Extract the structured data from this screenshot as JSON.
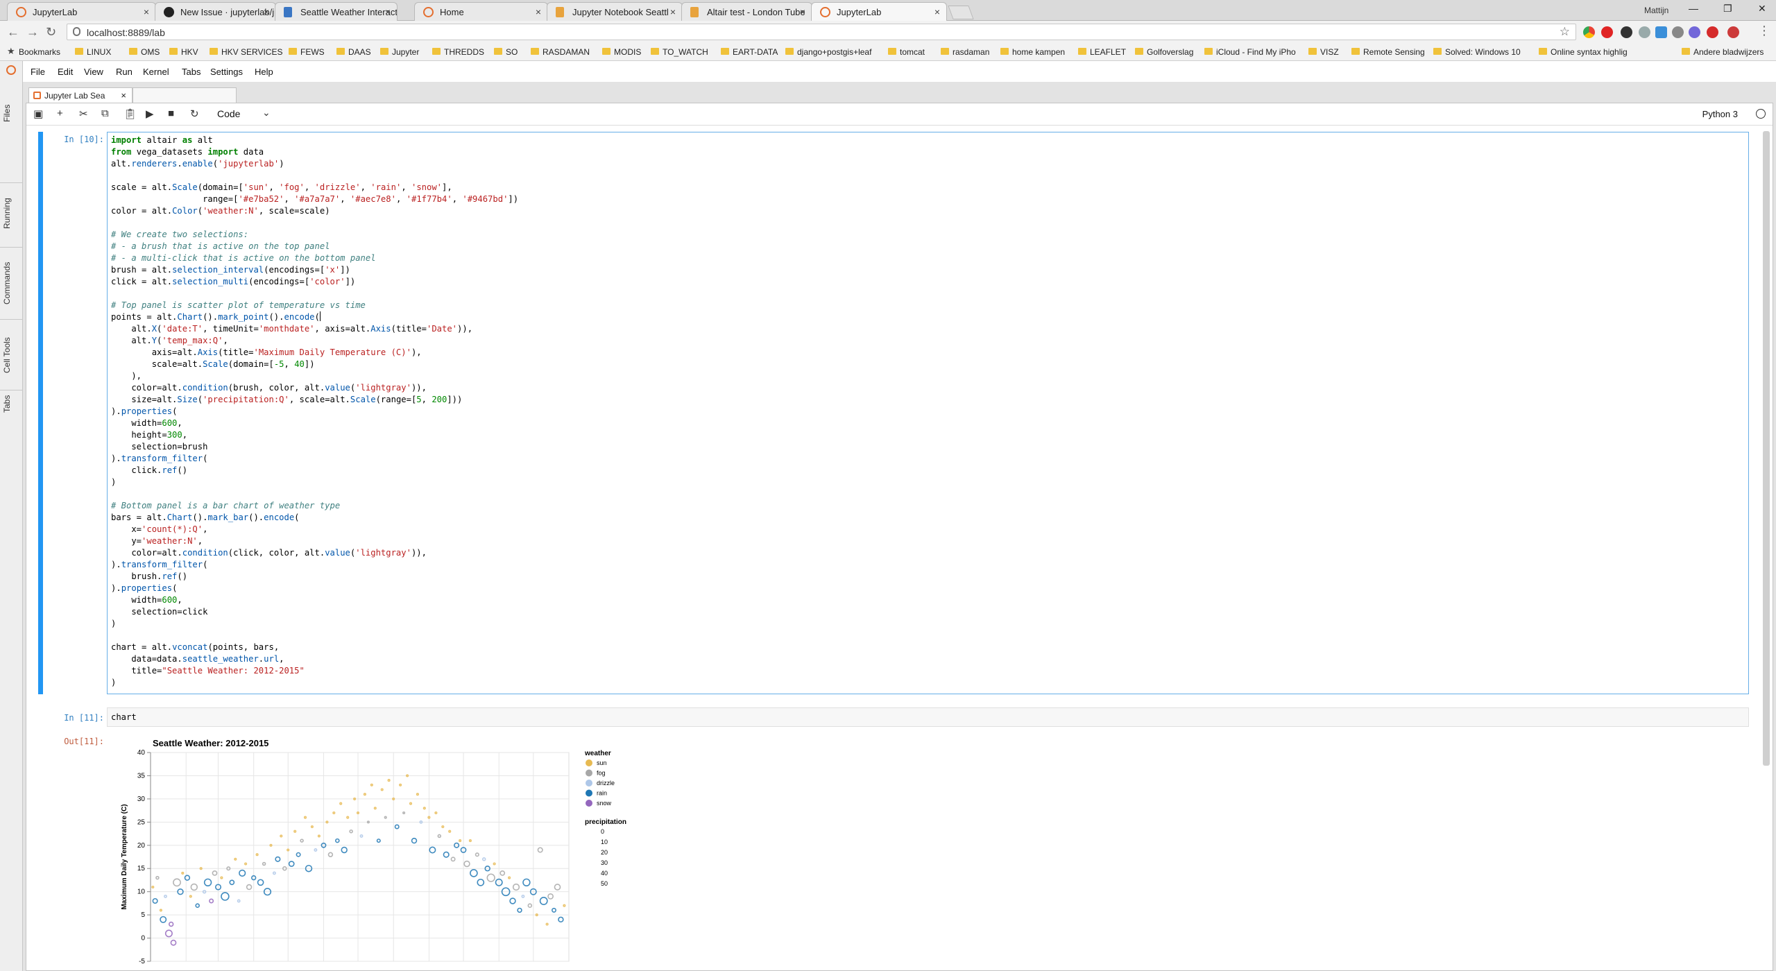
{
  "browser": {
    "tabs": [
      {
        "label": "JupyterLab",
        "icon": "jupyter-icon"
      },
      {
        "label": "New Issue · jupyterlab/ju",
        "icon": "github-icon"
      },
      {
        "label": "Seattle Weather Interacti",
        "icon": "document-icon"
      },
      {
        "label": "Home",
        "icon": "jupyter-icon"
      },
      {
        "label": "Jupyter Notebook Seattl",
        "icon": "notebook-icon"
      },
      {
        "label": "Altair test - London Tube",
        "icon": "notebook-icon"
      },
      {
        "label": "JupyterLab",
        "icon": "jupyter-icon",
        "active": true
      }
    ],
    "profile": "Mattijn",
    "url": "localhost:8889/lab",
    "bookmarks": [
      "Bookmarks",
      "LINUX",
      "OMS",
      "HKV",
      "HKV SERVICES",
      "FEWS",
      "DAAS",
      "Jupyter",
      "THREDDS",
      "SO",
      "RASDAMAN",
      "MODIS",
      "TO_WATCH",
      "EART-DATA",
      "django+postgis+leaf",
      "tomcat",
      "rasdaman",
      "home kampen",
      "LEAFLET",
      "Golfoverslag",
      "iCloud - Find My iPho",
      "VISZ",
      "Remote Sensing",
      "Solved: Windows 10",
      "Online syntax highlig",
      "Andere bladwijzers"
    ]
  },
  "jupyter": {
    "sidebar": [
      "Files",
      "Running",
      "Commands",
      "Cell Tools",
      "Tabs"
    ],
    "menus": [
      "File",
      "Edit",
      "View",
      "Run",
      "Kernel",
      "Tabs",
      "Settings",
      "Help"
    ],
    "doc_tab": "Jupyter Lab Sea",
    "cell_type": "Code",
    "kernel": "Python 3",
    "cells": [
      {
        "prompt": "In [10]:"
      },
      {
        "prompt": "In [11]:",
        "code": "chart"
      },
      {
        "prompt": "Out[11]:"
      }
    ]
  },
  "chart_data": {
    "type": "scatter",
    "title": "Seattle Weather: 2012-2015",
    "ylabel": "Maximum Daily Temperature (C)",
    "ylim": [
      -5,
      40
    ],
    "yticks": [
      -5,
      0,
      5,
      10,
      15,
      20,
      25,
      30,
      35,
      40
    ],
    "x_domain": "month-date, Jan 1 to Dec 31",
    "legend_color_title": "weather",
    "legend_color": [
      {
        "label": "sun",
        "color": "#e7ba52"
      },
      {
        "label": "fog",
        "color": "#a7a7a7"
      },
      {
        "label": "drizzle",
        "color": "#aec7e8"
      },
      {
        "label": "rain",
        "color": "#1f77b4"
      },
      {
        "label": "snow",
        "color": "#9467bd"
      }
    ],
    "legend_size_title": "precipitation",
    "legend_size": [
      0,
      10,
      20,
      30,
      40,
      50
    ],
    "points": [
      {
        "x": "Jan 03",
        "y": 11,
        "weather": "sun",
        "precip": 0
      },
      {
        "x": "Jan 05",
        "y": 8,
        "weather": "rain",
        "precip": 8
      },
      {
        "x": "Jan 07",
        "y": 13,
        "weather": "fog",
        "precip": 2
      },
      {
        "x": "Jan 10",
        "y": 6,
        "weather": "sun",
        "precip": 0
      },
      {
        "x": "Jan 12",
        "y": 4,
        "weather": "rain",
        "precip": 14
      },
      {
        "x": "Jan 14",
        "y": 9,
        "weather": "drizzle",
        "precip": 1
      },
      {
        "x": "Jan 17",
        "y": 1,
        "weather": "snow",
        "precip": 18
      },
      {
        "x": "Jan 19",
        "y": 3,
        "weather": "snow",
        "precip": 6
      },
      {
        "x": "Jan 21",
        "y": -1,
        "weather": "snow",
        "precip": 10
      },
      {
        "x": "Jan 24",
        "y": 12,
        "weather": "fog",
        "precip": 22
      },
      {
        "x": "Jan 27",
        "y": 10,
        "weather": "rain",
        "precip": 12
      },
      {
        "x": "Jan 29",
        "y": 14,
        "weather": "sun",
        "precip": 0
      },
      {
        "x": "Feb 02",
        "y": 13,
        "weather": "rain",
        "precip": 9
      },
      {
        "x": "Feb 05",
        "y": 9,
        "weather": "sun",
        "precip": 0
      },
      {
        "x": "Feb 08",
        "y": 11,
        "weather": "fog",
        "precip": 16
      },
      {
        "x": "Feb 11",
        "y": 7,
        "weather": "rain",
        "precip": 4
      },
      {
        "x": "Feb 14",
        "y": 15,
        "weather": "sun",
        "precip": 0
      },
      {
        "x": "Feb 17",
        "y": 10,
        "weather": "drizzle",
        "precip": 2
      },
      {
        "x": "Feb 20",
        "y": 12,
        "weather": "rain",
        "precip": 20
      },
      {
        "x": "Feb 23",
        "y": 8,
        "weather": "snow",
        "precip": 5
      },
      {
        "x": "Feb 26",
        "y": 14,
        "weather": "fog",
        "precip": 7
      },
      {
        "x": "Mar 01",
        "y": 11,
        "weather": "rain",
        "precip": 11
      },
      {
        "x": "Mar 04",
        "y": 13,
        "weather": "sun",
        "precip": 0
      },
      {
        "x": "Mar 07",
        "y": 9,
        "weather": "rain",
        "precip": 25
      },
      {
        "x": "Mar 10",
        "y": 15,
        "weather": "fog",
        "precip": 3
      },
      {
        "x": "Mar 13",
        "y": 12,
        "weather": "rain",
        "precip": 7
      },
      {
        "x": "Mar 16",
        "y": 17,
        "weather": "sun",
        "precip": 0
      },
      {
        "x": "Mar 19",
        "y": 8,
        "weather": "drizzle",
        "precip": 1
      },
      {
        "x": "Mar 22",
        "y": 14,
        "weather": "rain",
        "precip": 15
      },
      {
        "x": "Mar 25",
        "y": 16,
        "weather": "sun",
        "precip": 0
      },
      {
        "x": "Mar 28",
        "y": 11,
        "weather": "fog",
        "precip": 9
      },
      {
        "x": "Apr 01",
        "y": 13,
        "weather": "rain",
        "precip": 6
      },
      {
        "x": "Apr 04",
        "y": 18,
        "weather": "sun",
        "precip": 0
      },
      {
        "x": "Apr 07",
        "y": 12,
        "weather": "rain",
        "precip": 13
      },
      {
        "x": "Apr 10",
        "y": 16,
        "weather": "fog",
        "precip": 2
      },
      {
        "x": "Apr 13",
        "y": 10,
        "weather": "rain",
        "precip": 19
      },
      {
        "x": "Apr 16",
        "y": 20,
        "weather": "sun",
        "precip": 0
      },
      {
        "x": "Apr 19",
        "y": 14,
        "weather": "drizzle",
        "precip": 1
      },
      {
        "x": "Apr 22",
        "y": 17,
        "weather": "rain",
        "precip": 8
      },
      {
        "x": "Apr 25",
        "y": 22,
        "weather": "sun",
        "precip": 0
      },
      {
        "x": "Apr 28",
        "y": 15,
        "weather": "fog",
        "precip": 4
      },
      {
        "x": "May 01",
        "y": 19,
        "weather": "sun",
        "precip": 0
      },
      {
        "x": "May 04",
        "y": 16,
        "weather": "rain",
        "precip": 10
      },
      {
        "x": "May 07",
        "y": 23,
        "weather": "sun",
        "precip": 0
      },
      {
        "x": "May 10",
        "y": 18,
        "weather": "rain",
        "precip": 5
      },
      {
        "x": "May 13",
        "y": 21,
        "weather": "fog",
        "precip": 2
      },
      {
        "x": "May 16",
        "y": 26,
        "weather": "sun",
        "precip": 0
      },
      {
        "x": "May 19",
        "y": 15,
        "weather": "rain",
        "precip": 16
      },
      {
        "x": "May 22",
        "y": 24,
        "weather": "sun",
        "precip": 0
      },
      {
        "x": "May 25",
        "y": 19,
        "weather": "drizzle",
        "precip": 1
      },
      {
        "x": "May 28",
        "y": 22,
        "weather": "sun",
        "precip": 0
      },
      {
        "x": "Jun 01",
        "y": 20,
        "weather": "rain",
        "precip": 7
      },
      {
        "x": "Jun 04",
        "y": 25,
        "weather": "sun",
        "precip": 0
      },
      {
        "x": "Jun 07",
        "y": 18,
        "weather": "fog",
        "precip": 6
      },
      {
        "x": "Jun 10",
        "y": 27,
        "weather": "sun",
        "precip": 0
      },
      {
        "x": "Jun 13",
        "y": 21,
        "weather": "rain",
        "precip": 4
      },
      {
        "x": "Jun 16",
        "y": 29,
        "weather": "sun",
        "precip": 0
      },
      {
        "x": "Jun 19",
        "y": 19,
        "weather": "rain",
        "precip": 12
      },
      {
        "x": "Jun 22",
        "y": 26,
        "weather": "sun",
        "precip": 0
      },
      {
        "x": "Jun 25",
        "y": 23,
        "weather": "fog",
        "precip": 2
      },
      {
        "x": "Jun 28",
        "y": 30,
        "weather": "sun",
        "precip": 0
      },
      {
        "x": "Jul 01",
        "y": 27,
        "weather": "sun",
        "precip": 0
      },
      {
        "x": "Jul 04",
        "y": 22,
        "weather": "drizzle",
        "precip": 1
      },
      {
        "x": "Jul 07",
        "y": 31,
        "weather": "sun",
        "precip": 0
      },
      {
        "x": "Jul 10",
        "y": 25,
        "weather": "fog",
        "precip": 0
      },
      {
        "x": "Jul 13",
        "y": 33,
        "weather": "sun",
        "precip": 0
      },
      {
        "x": "Jul 16",
        "y": 28,
        "weather": "sun",
        "precip": 0
      },
      {
        "x": "Jul 19",
        "y": 21,
        "weather": "rain",
        "precip": 3
      },
      {
        "x": "Jul 22",
        "y": 32,
        "weather": "sun",
        "precip": 0
      },
      {
        "x": "Jul 25",
        "y": 26,
        "weather": "fog",
        "precip": 0
      },
      {
        "x": "Jul 28",
        "y": 34,
        "weather": "sun",
        "precip": 0
      },
      {
        "x": "Aug 01",
        "y": 30,
        "weather": "sun",
        "precip": 0
      },
      {
        "x": "Aug 04",
        "y": 24,
        "weather": "rain",
        "precip": 5
      },
      {
        "x": "Aug 07",
        "y": 33,
        "weather": "sun",
        "precip": 0
      },
      {
        "x": "Aug 10",
        "y": 27,
        "weather": "fog",
        "precip": 0
      },
      {
        "x": "Aug 13",
        "y": 35,
        "weather": "sun",
        "precip": 0
      },
      {
        "x": "Aug 16",
        "y": 29,
        "weather": "sun",
        "precip": 0
      },
      {
        "x": "Aug 19",
        "y": 21,
        "weather": "rain",
        "precip": 9
      },
      {
        "x": "Aug 22",
        "y": 31,
        "weather": "sun",
        "precip": 0
      },
      {
        "x": "Aug 25",
        "y": 25,
        "weather": "drizzle",
        "precip": 1
      },
      {
        "x": "Aug 28",
        "y": 28,
        "weather": "sun",
        "precip": 0
      },
      {
        "x": "Sep 01",
        "y": 26,
        "weather": "sun",
        "precip": 0
      },
      {
        "x": "Sep 04",
        "y": 19,
        "weather": "rain",
        "precip": 14
      },
      {
        "x": "Sep 07",
        "y": 27,
        "weather": "sun",
        "precip": 0
      },
      {
        "x": "Sep 10",
        "y": 22,
        "weather": "fog",
        "precip": 2
      },
      {
        "x": "Sep 13",
        "y": 24,
        "weather": "sun",
        "precip": 0
      },
      {
        "x": "Sep 16",
        "y": 18,
        "weather": "rain",
        "precip": 11
      },
      {
        "x": "Sep 19",
        "y": 23,
        "weather": "sun",
        "precip": 0
      },
      {
        "x": "Sep 22",
        "y": 17,
        "weather": "fog",
        "precip": 5
      },
      {
        "x": "Sep 25",
        "y": 20,
        "weather": "rain",
        "precip": 8
      },
      {
        "x": "Sep 28",
        "y": 21,
        "weather": "sun",
        "precip": 0
      },
      {
        "x": "Oct 01",
        "y": 19,
        "weather": "rain",
        "precip": 10
      },
      {
        "x": "Oct 04",
        "y": 16,
        "weather": "fog",
        "precip": 12
      },
      {
        "x": "Oct 07",
        "y": 21,
        "weather": "sun",
        "precip": 0
      },
      {
        "x": "Oct 10",
        "y": 14,
        "weather": "rain",
        "precip": 21
      },
      {
        "x": "Oct 13",
        "y": 18,
        "weather": "fog",
        "precip": 3
      },
      {
        "x": "Oct 16",
        "y": 12,
        "weather": "rain",
        "precip": 17
      },
      {
        "x": "Oct 19",
        "y": 17,
        "weather": "drizzle",
        "precip": 2
      },
      {
        "x": "Oct 22",
        "y": 15,
        "weather": "rain",
        "precip": 9
      },
      {
        "x": "Oct 25",
        "y": 13,
        "weather": "fog",
        "precip": 24
      },
      {
        "x": "Oct 28",
        "y": 16,
        "weather": "sun",
        "precip": 0
      },
      {
        "x": "Nov 01",
        "y": 12,
        "weather": "rain",
        "precip": 18
      },
      {
        "x": "Nov 04",
        "y": 14,
        "weather": "fog",
        "precip": 7
      },
      {
        "x": "Nov 07",
        "y": 10,
        "weather": "rain",
        "precip": 26
      },
      {
        "x": "Nov 10",
        "y": 13,
        "weather": "sun",
        "precip": 0
      },
      {
        "x": "Nov 13",
        "y": 8,
        "weather": "rain",
        "precip": 12
      },
      {
        "x": "Nov 16",
        "y": 11,
        "weather": "fog",
        "precip": 15
      },
      {
        "x": "Nov 19",
        "y": 6,
        "weather": "rain",
        "precip": 6
      },
      {
        "x": "Nov 22",
        "y": 9,
        "weather": "drizzle",
        "precip": 1
      },
      {
        "x": "Nov 25",
        "y": 12,
        "weather": "rain",
        "precip": 20
      },
      {
        "x": "Nov 28",
        "y": 7,
        "weather": "fog",
        "precip": 4
      },
      {
        "x": "Dec 01",
        "y": 10,
        "weather": "rain",
        "precip": 14
      },
      {
        "x": "Dec 04",
        "y": 5,
        "weather": "sun",
        "precip": 0
      },
      {
        "x": "Dec 07",
        "y": 19,
        "weather": "fog",
        "precip": 8
      },
      {
        "x": "Dec 10",
        "y": 8,
        "weather": "rain",
        "precip": 22
      },
      {
        "x": "Dec 13",
        "y": 3,
        "weather": "sun",
        "precip": 0
      },
      {
        "x": "Dec 16",
        "y": 9,
        "weather": "fog",
        "precip": 10
      },
      {
        "x": "Dec 19",
        "y": 6,
        "weather": "rain",
        "precip": 5
      },
      {
        "x": "Dec 22",
        "y": 11,
        "weather": "fog",
        "precip": 13
      },
      {
        "x": "Dec 25",
        "y": 4,
        "weather": "rain",
        "precip": 9
      },
      {
        "x": "Dec 28",
        "y": 7,
        "weather": "sun",
        "precip": 0
      }
    ]
  }
}
